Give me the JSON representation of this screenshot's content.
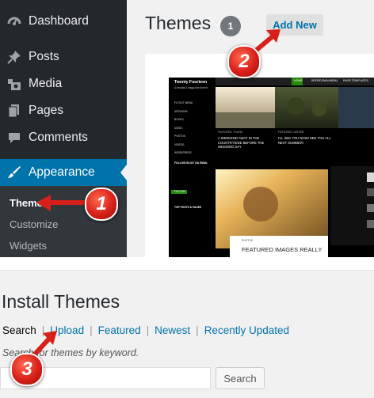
{
  "sidebar": {
    "items": [
      {
        "label": "Dashboard",
        "icon": "dashboard-icon"
      },
      {
        "label": "Posts",
        "icon": "pushpin-icon"
      },
      {
        "label": "Media",
        "icon": "media-icon"
      },
      {
        "label": "Pages",
        "icon": "pages-icon"
      },
      {
        "label": "Comments",
        "icon": "comments-icon"
      },
      {
        "label": "Appearance",
        "icon": "paintbrush-icon"
      }
    ],
    "submenu": [
      "Themes",
      "Customize",
      "Widgets"
    ]
  },
  "themes_page": {
    "title": "Themes",
    "count": "1",
    "add_new": "Add New"
  },
  "theme_preview": {
    "site_title": "Twenty Fourteen",
    "tagline": "A beautiful magazine theme",
    "nav": [
      "HOME",
      "DROPDOWN MENU",
      "PAGE TEMPLATES"
    ],
    "sidebar_links": [
      "FLYOUT MENU",
      "ARTWORK",
      "BOOKS",
      "MUSIC",
      "PHOTOS",
      "VIDEOS",
      "WORDPRESS"
    ],
    "follow_heading": "FOLLOW BLOG VIA EMAIL",
    "follow_button": "FOLLOW",
    "top_posts_heading": "TOP POSTS & PAGES",
    "featured": [
      {
        "label": "FEATURED, TRAVEL",
        "title": "A WEEKEND AWAY IN THE COUNTRYSIDE BEFORE THE WEDDING DAY"
      },
      {
        "label": "FEATURED, NATURE",
        "title": "I'LL SEE YOU NOW! SEE YOU ALL NEXT SUMMER!"
      }
    ],
    "photos_label": "PHOTOS",
    "main_post_title": "FEATURED IMAGES REALLY"
  },
  "install": {
    "title": "Install Themes",
    "filters": {
      "search": "Search",
      "upload": "Upload",
      "featured": "Featured",
      "newest": "Newest",
      "recently_updated": "Recently Updated"
    },
    "search_desc": "Search for themes by keyword.",
    "search_button": "Search"
  },
  "callouts": [
    "1",
    "2",
    "3"
  ],
  "colors": {
    "sidebar_bg": "#23282d",
    "active_bg": "#0073aa",
    "link": "#0073aa",
    "callout": "#d8201a"
  }
}
